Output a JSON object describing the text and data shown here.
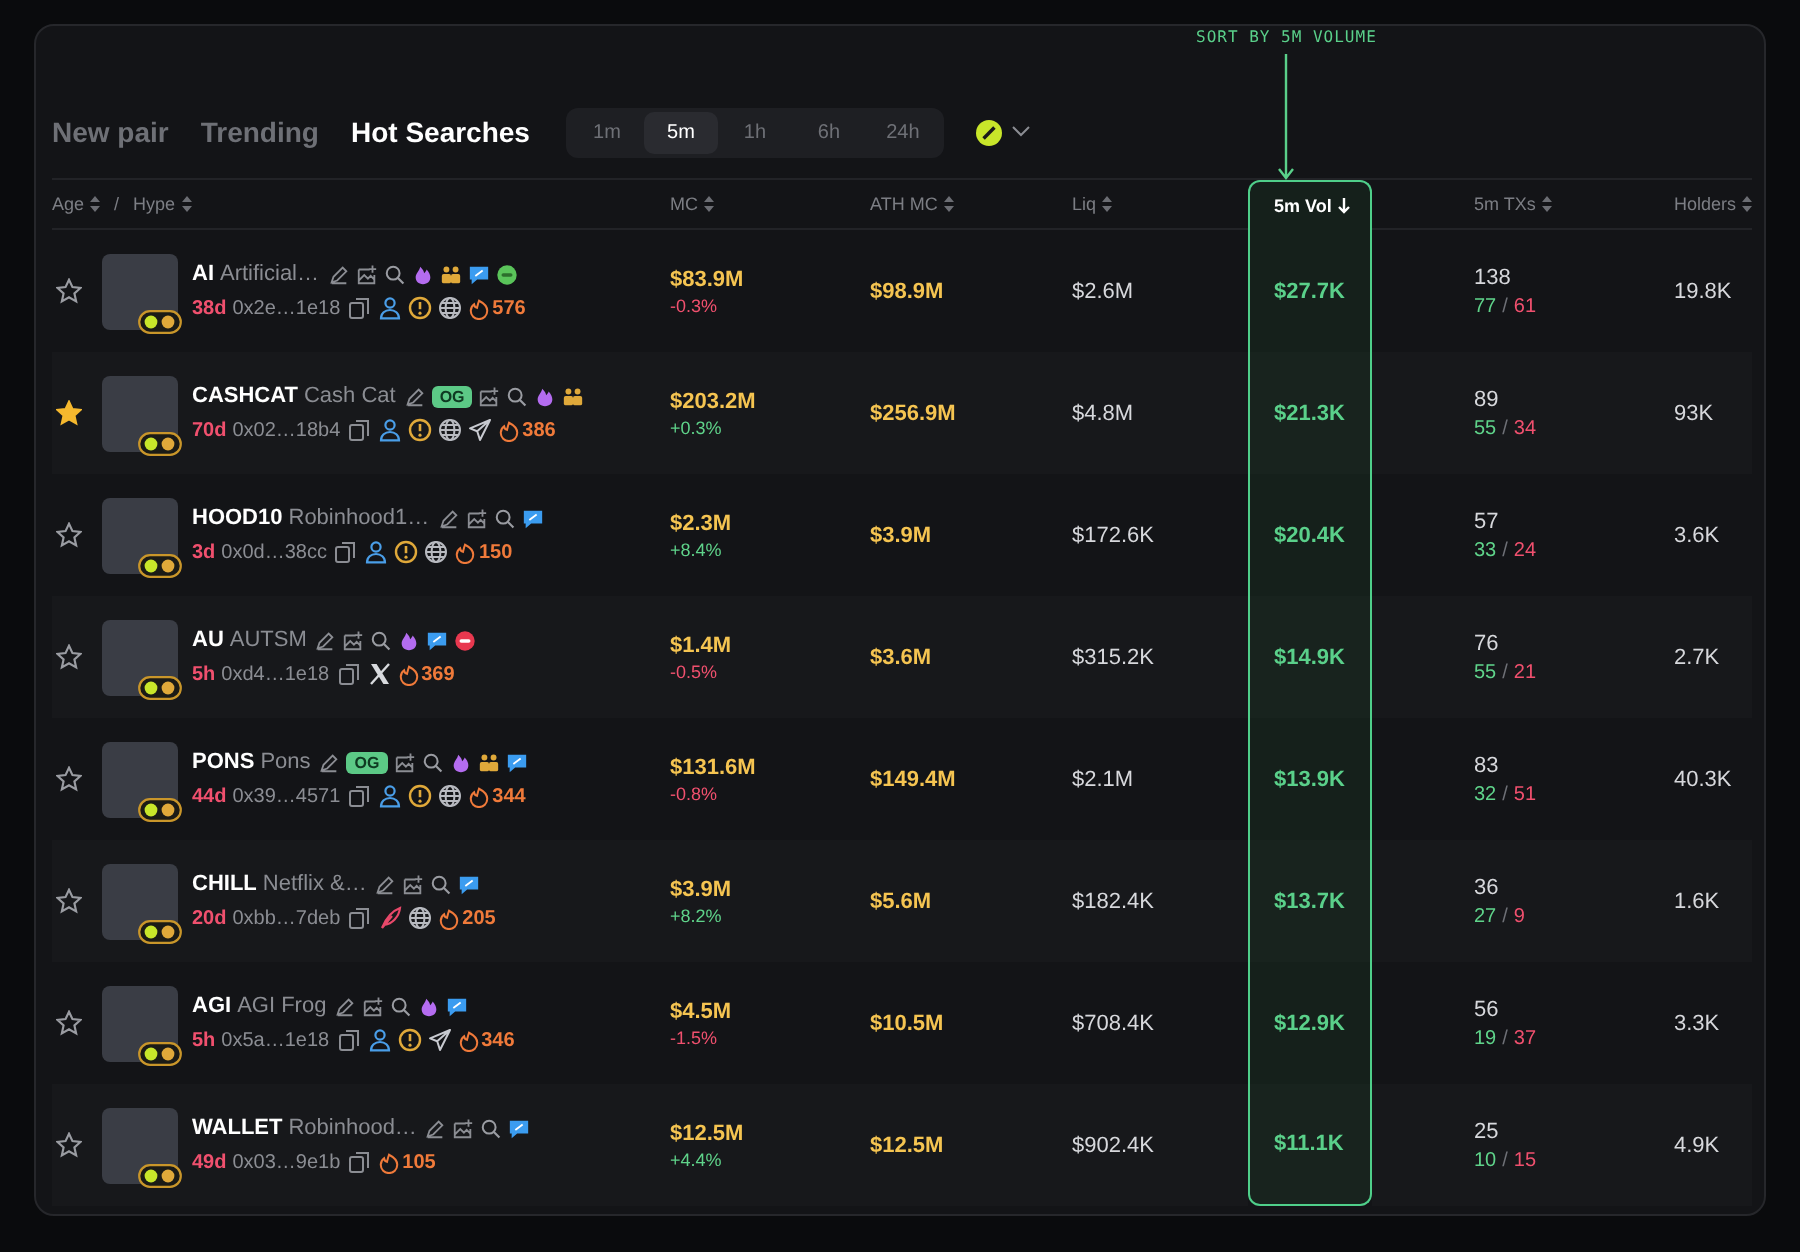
{
  "annotation": {
    "text": "SORT BY 5M VOLUME"
  },
  "tabs": [
    {
      "label": "New pair",
      "selected": false
    },
    {
      "label": "Trending",
      "selected": false
    },
    {
      "label": "Hot Searches",
      "selected": true
    }
  ],
  "time_filters": [
    {
      "label": "1m",
      "selected": false
    },
    {
      "label": "5m",
      "selected": true
    },
    {
      "label": "1h",
      "selected": false
    },
    {
      "label": "6h",
      "selected": false
    },
    {
      "label": "24h",
      "selected": false
    }
  ],
  "header": {
    "token_labels": [
      {
        "label": "Age",
        "sorted": false
      },
      {
        "label": "Hype",
        "sorted": false
      }
    ],
    "separator": "/",
    "columns": [
      {
        "label": "MC",
        "sorted": false
      },
      {
        "label": "ATH MC",
        "sorted": false
      },
      {
        "label": "Liq",
        "sorted": false
      },
      {
        "label": "5m Vol",
        "sorted": true
      },
      {
        "label": "5m TXs",
        "sorted": false
      },
      {
        "label": "Holders",
        "sorted": false
      }
    ]
  },
  "rows": [
    {
      "starred": false,
      "symbol": "AI",
      "name": "Artificial…",
      "badges": [
        {
          "kind": "edit"
        },
        {
          "kind": "image"
        },
        {
          "kind": "search"
        },
        {
          "kind": "fire"
        },
        {
          "kind": "people"
        },
        {
          "kind": "chat"
        },
        {
          "kind": "coin"
        }
      ],
      "age": "38d",
      "address": "0x2e…1e18",
      "links": [
        {
          "kind": "copy"
        },
        {
          "kind": "user"
        },
        {
          "kind": "warning"
        },
        {
          "kind": "globe"
        }
      ],
      "hype": "576",
      "mc": "$83.9M",
      "mc_change": "-0.3%",
      "mc_up": false,
      "ath_mc": "$98.9M",
      "liq": "$2.6M",
      "vol": "$27.7K",
      "txs": "138",
      "tx_separator": "/",
      "buys": "77",
      "sells": "61",
      "holders": "19.8K"
    },
    {
      "starred": true,
      "symbol": "CASHCAT",
      "name": "Cash Cat",
      "badges": [
        {
          "kind": "edit"
        },
        {
          "kind": "og",
          "label": "OG"
        },
        {
          "kind": "image"
        },
        {
          "kind": "search"
        },
        {
          "kind": "fire"
        },
        {
          "kind": "people"
        }
      ],
      "age": "70d",
      "address": "0x02…18b4",
      "links": [
        {
          "kind": "copy"
        },
        {
          "kind": "user"
        },
        {
          "kind": "warning"
        },
        {
          "kind": "globe"
        },
        {
          "kind": "telegram"
        }
      ],
      "hype": "386",
      "mc": "$203.2M",
      "mc_change": "+0.3%",
      "mc_up": true,
      "ath_mc": "$256.9M",
      "liq": "$4.8M",
      "vol": "$21.3K",
      "txs": "89",
      "tx_separator": "/",
      "buys": "55",
      "sells": "34",
      "holders": "93K"
    },
    {
      "starred": false,
      "symbol": "HOOD10",
      "name": "Robinhood1…",
      "badges": [
        {
          "kind": "edit"
        },
        {
          "kind": "image"
        },
        {
          "kind": "search"
        },
        {
          "kind": "chat"
        }
      ],
      "age": "3d",
      "address": "0x0d…38cc",
      "links": [
        {
          "kind": "copy"
        },
        {
          "kind": "user"
        },
        {
          "kind": "warning"
        },
        {
          "kind": "globe"
        }
      ],
      "hype": "150",
      "mc": "$2.3M",
      "mc_change": "+8.4%",
      "mc_up": true,
      "ath_mc": "$3.9M",
      "liq": "$172.6K",
      "vol": "$20.4K",
      "txs": "57",
      "tx_separator": "/",
      "buys": "33",
      "sells": "24",
      "holders": "3.6K"
    },
    {
      "starred": false,
      "symbol": "AU",
      "name": "AUTSM",
      "badges": [
        {
          "kind": "edit"
        },
        {
          "kind": "image"
        },
        {
          "kind": "search"
        },
        {
          "kind": "fire"
        },
        {
          "kind": "chat"
        },
        {
          "kind": "stop"
        }
      ],
      "age": "5h",
      "address": "0xd4…1e18",
      "links": [
        {
          "kind": "copy"
        },
        {
          "kind": "x"
        }
      ],
      "hype": "369",
      "mc": "$1.4M",
      "mc_change": "-0.5%",
      "mc_up": false,
      "ath_mc": "$3.6M",
      "liq": "$315.2K",
      "vol": "$14.9K",
      "txs": "76",
      "tx_separator": "/",
      "buys": "55",
      "sells": "21",
      "holders": "2.7K"
    },
    {
      "starred": false,
      "symbol": "PONS",
      "name": "Pons",
      "badges": [
        {
          "kind": "edit"
        },
        {
          "kind": "og",
          "label": "OG"
        },
        {
          "kind": "image"
        },
        {
          "kind": "search"
        },
        {
          "kind": "fire"
        },
        {
          "kind": "people"
        },
        {
          "kind": "chat"
        }
      ],
      "age": "44d",
      "address": "0x39…4571",
      "links": [
        {
          "kind": "copy"
        },
        {
          "kind": "user"
        },
        {
          "kind": "warning"
        },
        {
          "kind": "globe"
        }
      ],
      "hype": "344",
      "mc": "$131.6M",
      "mc_change": "-0.8%",
      "mc_up": false,
      "ath_mc": "$149.4M",
      "liq": "$2.1M",
      "vol": "$13.9K",
      "txs": "83",
      "tx_separator": "/",
      "buys": "32",
      "sells": "51",
      "holders": "40.3K"
    },
    {
      "starred": false,
      "symbol": "CHILL",
      "name": "Netflix &…",
      "badges": [
        {
          "kind": "edit"
        },
        {
          "kind": "image"
        },
        {
          "kind": "search"
        },
        {
          "kind": "chat"
        }
      ],
      "age": "20d",
      "address": "0xbb…7deb",
      "links": [
        {
          "kind": "copy"
        },
        {
          "kind": "feather"
        },
        {
          "kind": "globe"
        }
      ],
      "hype": "205",
      "mc": "$3.9M",
      "mc_change": "+8.2%",
      "mc_up": true,
      "ath_mc": "$5.6M",
      "liq": "$182.4K",
      "vol": "$13.7K",
      "txs": "36",
      "tx_separator": "/",
      "buys": "27",
      "sells": "9",
      "holders": "1.6K"
    },
    {
      "starred": false,
      "symbol": "AGI",
      "name": "AGI Frog",
      "badges": [
        {
          "kind": "edit"
        },
        {
          "kind": "image"
        },
        {
          "kind": "search"
        },
        {
          "kind": "fire"
        },
        {
          "kind": "chat"
        }
      ],
      "age": "5h",
      "address": "0x5a…1e18",
      "links": [
        {
          "kind": "copy"
        },
        {
          "kind": "user"
        },
        {
          "kind": "warning"
        },
        {
          "kind": "telegram"
        }
      ],
      "hype": "346",
      "mc": "$4.5M",
      "mc_change": "-1.5%",
      "mc_up": false,
      "ath_mc": "$10.5M",
      "liq": "$708.4K",
      "vol": "$12.9K",
      "txs": "56",
      "tx_separator": "/",
      "buys": "19",
      "sells": "37",
      "holders": "3.3K"
    },
    {
      "starred": false,
      "symbol": "WALLET",
      "name": "Robinhood…",
      "badges": [
        {
          "kind": "edit"
        },
        {
          "kind": "image"
        },
        {
          "kind": "search"
        },
        {
          "kind": "chat"
        }
      ],
      "age": "49d",
      "address": "0x03…9e1b",
      "links": [
        {
          "kind": "copy"
        }
      ],
      "hype": "105",
      "mc": "$12.5M",
      "mc_change": "+4.4%",
      "mc_up": true,
      "ath_mc": "$12.5M",
      "liq": "$902.4K",
      "vol": "$11.1K",
      "txs": "25",
      "tx_separator": "/",
      "buys": "10",
      "sells": "15",
      "holders": "4.9K"
    }
  ]
}
